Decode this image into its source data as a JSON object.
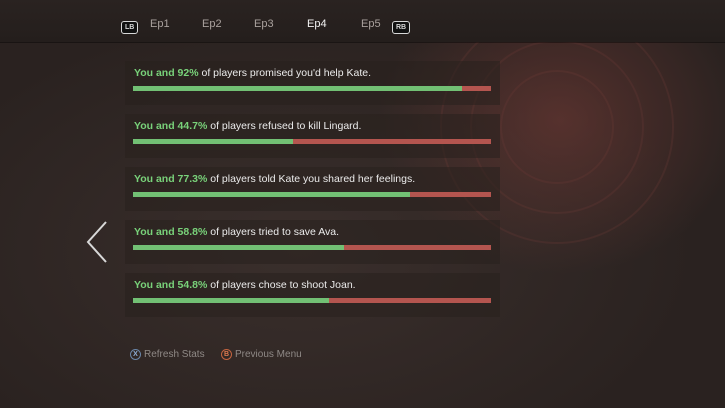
{
  "header": {
    "left_bumper": "LB",
    "right_bumper": "RB",
    "tabs": [
      {
        "label": "Ep1",
        "active": false
      },
      {
        "label": "Ep2",
        "active": false
      },
      {
        "label": "Ep3",
        "active": false
      },
      {
        "label": "Ep4",
        "active": true
      },
      {
        "label": "Ep5",
        "active": false
      }
    ]
  },
  "stats": [
    {
      "prefix": "You and 92%",
      "text": " of players promised you'd help Kate.",
      "percent": 92
    },
    {
      "prefix": "You and 44.7%",
      "text": " of players refused to kill Lingard.",
      "percent": 44.7
    },
    {
      "prefix": "You and 77.3%",
      "text": " of players told Kate you shared her feelings.",
      "percent": 77.3
    },
    {
      "prefix": "You and 58.8%",
      "text": " of players tried to save Ava.",
      "percent": 58.8
    },
    {
      "prefix": "You and 54.8%",
      "text": " of players chose to shoot Joan.",
      "percent": 54.8
    }
  ],
  "footer": {
    "refresh": {
      "glyph": "X",
      "label": "Refresh Stats"
    },
    "back": {
      "glyph": "B",
      "label": "Previous Menu"
    }
  },
  "colors": {
    "agree": "#72c074",
    "disagree": "#b4554f",
    "highlight": "#79d27a"
  },
  "icons": {
    "back": "chevron-left-icon"
  }
}
